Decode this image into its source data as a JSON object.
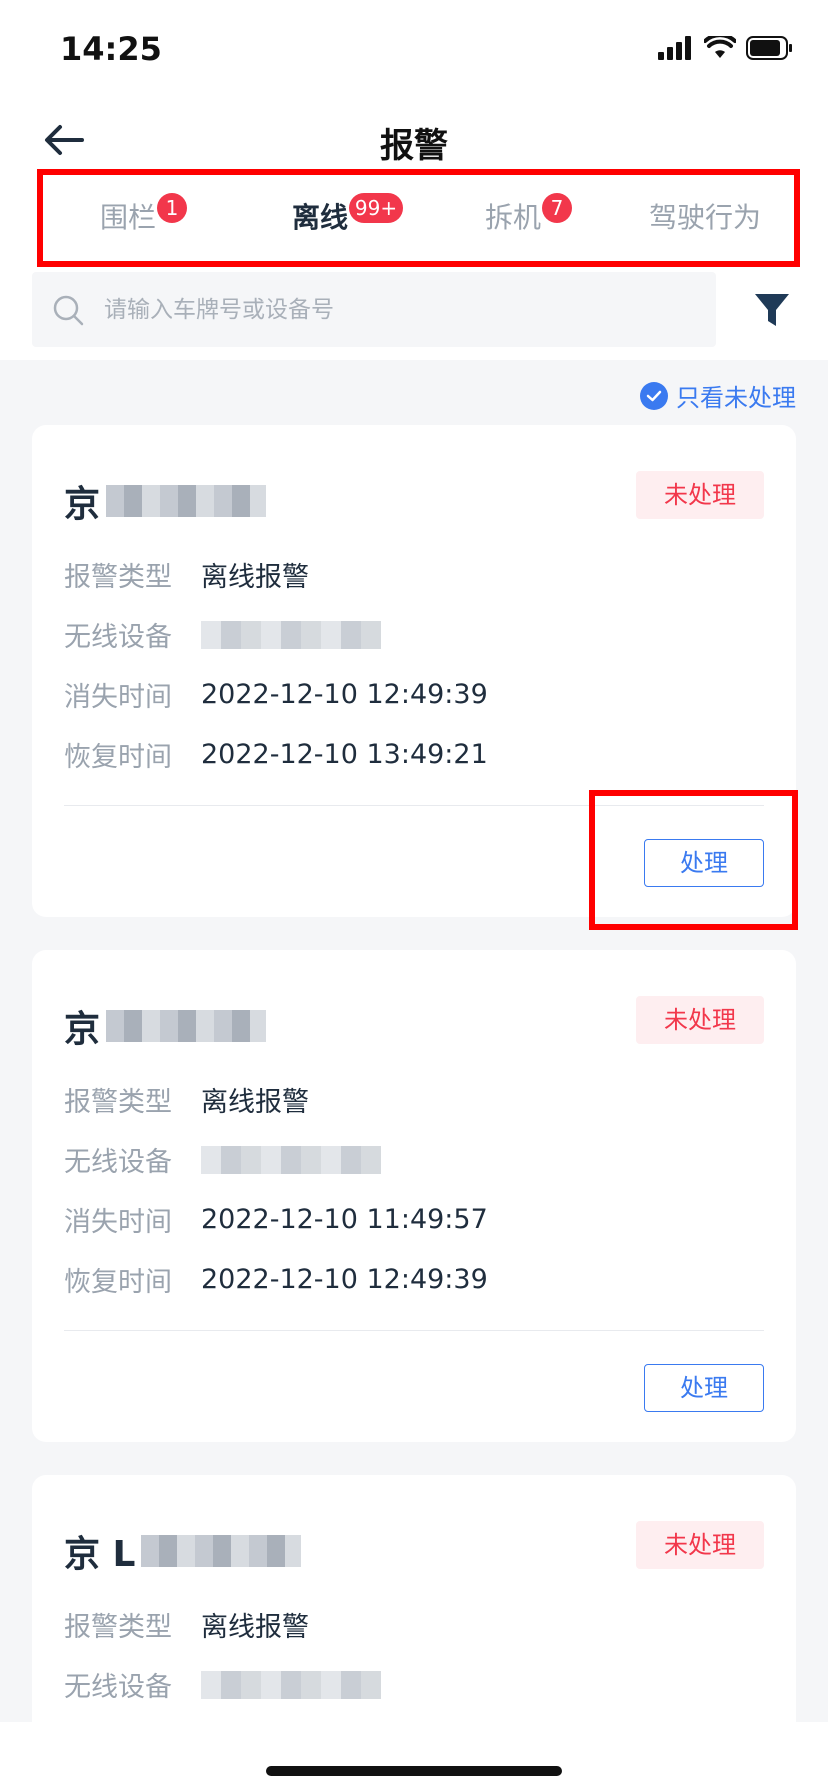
{
  "status_bar": {
    "time": "14:25"
  },
  "nav": {
    "title": "报警"
  },
  "tabs": [
    {
      "label": "围栏",
      "badge": "1"
    },
    {
      "label": "离线",
      "badge": "99+",
      "active": true
    },
    {
      "label": "拆机",
      "badge": "7"
    },
    {
      "label": "驾驶行为"
    }
  ],
  "search": {
    "placeholder": "请输入车牌号或设备号"
  },
  "filter_toggle": {
    "label": "只看未处理",
    "checked": true
  },
  "labels": {
    "alarm_type": "报警类型",
    "device": "无线设备",
    "lost_time": "消失时间",
    "recover_time": "恢复时间",
    "process_button": "处理",
    "status_unprocessed": "未处理"
  },
  "cards": [
    {
      "plate": "京",
      "alarm_type": "离线报警",
      "lost_time": "2022-12-10 12:49:39",
      "recover_time": "2022-12-10 13:49:21"
    },
    {
      "plate": "京",
      "alarm_type": "离线报警",
      "lost_time": "2022-12-10 11:49:57",
      "recover_time": "2022-12-10 12:49:39"
    },
    {
      "plate": "京 L",
      "alarm_type": "离线报警"
    }
  ],
  "colors": {
    "accent": "#3a7af0",
    "alert": "#f2374b",
    "highlight": "#ff0000"
  }
}
